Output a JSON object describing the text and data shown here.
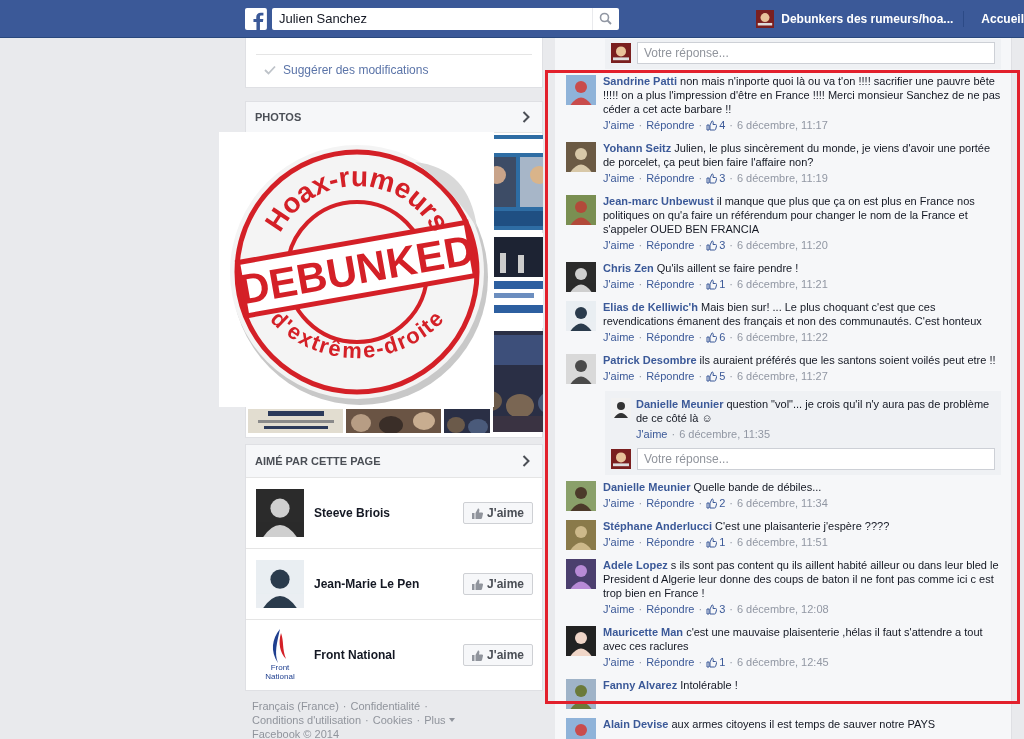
{
  "top_bar": {
    "search_value": "Julien Sanchez",
    "page_name": "Debunkers des rumeurs/hoa...",
    "home": "Accueil"
  },
  "separator": "·",
  "left": {
    "suggest": "Suggérer des modifications",
    "photos": {
      "title": "PHOTOS"
    },
    "sticker": {
      "top": "Hoax-rumeurs",
      "middle": "DEBUNKED",
      "bottom": "d'extrême-droite"
    },
    "liked": {
      "title": "AIMÉ PAR CETTE PAGE",
      "pages": [
        {
          "name": "Steeve Briois",
          "button": "J'aime"
        },
        {
          "name": "Jean-Marie Le Pen",
          "button": "J'aime"
        },
        {
          "name": "Front National",
          "button": "J'aime",
          "logo_text": "Front National"
        }
      ]
    },
    "footer": {
      "links": [
        "Français (France)",
        "Confidentialité",
        "Conditions d'utilisation",
        "Cookies",
        "Plus"
      ],
      "copyright": "Facebook © 2014"
    }
  },
  "comments_panel": {
    "top_reply_box": {
      "placeholder": "Votre réponse..."
    },
    "comments": [
      {
        "author": "Sandrine Patti",
        "text": "non mais n'inporte quoi là ou va t'on !!!! sacrifier une pauvre bête !!!!! on a plus l'impression d'être en France !!!! Merci monsieur Sanchez de ne pas céder a cet acte barbare !!",
        "actions": [
          "J'aime",
          "Répondre"
        ],
        "likes": "4",
        "time": "6 décembre, 11:17"
      },
      {
        "author": "Yohann Seitz",
        "text": "Julien, le plus sincèrement du monde, je viens d'avoir une portée de porcelet, ça peut bien faire l'affaire non?",
        "actions": [
          "J'aime",
          "Répondre"
        ],
        "likes": "3",
        "time": "6 décembre, 11:19"
      },
      {
        "author": "Jean-marc Unbewust",
        "text": "il manque que plus que ça on est plus en France nos politiques on qu'a faire un référendum pour changer le nom de la France et s'appeler OUED BEN FRANCIA",
        "actions": [
          "J'aime",
          "Répondre"
        ],
        "likes": "3",
        "time": "6 décembre, 11:20"
      },
      {
        "author": "Chris Zen",
        "text": "Qu'ils aillent se faire pendre !",
        "actions": [
          "J'aime",
          "Répondre"
        ],
        "likes": "1",
        "time": "6 décembre, 11:21"
      },
      {
        "author": "Elias de Kelliwic'h",
        "text": "Mais bien sur! ... Le plus choquant c'est que ces revendications émanent des français et non des communautés. C'est honteux",
        "actions": [
          "J'aime",
          "Répondre"
        ],
        "likes": "6",
        "time": "6 décembre, 11:22"
      },
      {
        "author": "Patrick Desombre",
        "text": "ils auraient préférés que les santons soient voilés peut etre !!",
        "actions": [
          "J'aime",
          "Répondre"
        ],
        "likes": "5",
        "time": "6 décembre, 11:27",
        "replies": [
          {
            "author": "Danielle Meunier",
            "text": "question \"vol\"... je crois qu'il n'y aura pas de problème de ce côté là ☺",
            "actions": [
              "J'aime"
            ],
            "time": "6 décembre, 11:35"
          }
        ],
        "reply_box": {
          "placeholder": "Votre réponse..."
        }
      },
      {
        "author": "Danielle Meunier",
        "text": "Quelle bande de débiles...",
        "actions": [
          "J'aime",
          "Répondre"
        ],
        "likes": "2",
        "time": "6 décembre, 11:34"
      },
      {
        "author": "Stéphane Anderlucci",
        "text": "C'est une plaisanterie j'espère ????",
        "actions": [
          "J'aime",
          "Répondre"
        ],
        "likes": "1",
        "time": "6 décembre, 11:51"
      },
      {
        "author": "Adele Lopez",
        "text": "s ils sont pas content qu ils aillent habité ailleur ou dans leur bled le President d Algerie leur donne des coups de baton il ne font pas comme ici c est trop bien en France !",
        "actions": [
          "J'aime",
          "Répondre"
        ],
        "likes": "3",
        "time": "6 décembre, 12:08"
      },
      {
        "author": "Mauricette Man",
        "text": "c'est une mauvaise plaisenterie ,hélas il faut s'attendre a tout avec ces raclures",
        "actions": [
          "J'aime",
          "Répondre"
        ],
        "likes": "1",
        "time": "6 décembre, 12:45"
      },
      {
        "author": "Fanny Alvarez",
        "text": "Intolérable !"
      },
      {
        "author": "Alain Devise",
        "text": "aux armes citoyens il est temps de sauver notre PAYS"
      }
    ]
  },
  "highlight": {
    "shown": true
  }
}
